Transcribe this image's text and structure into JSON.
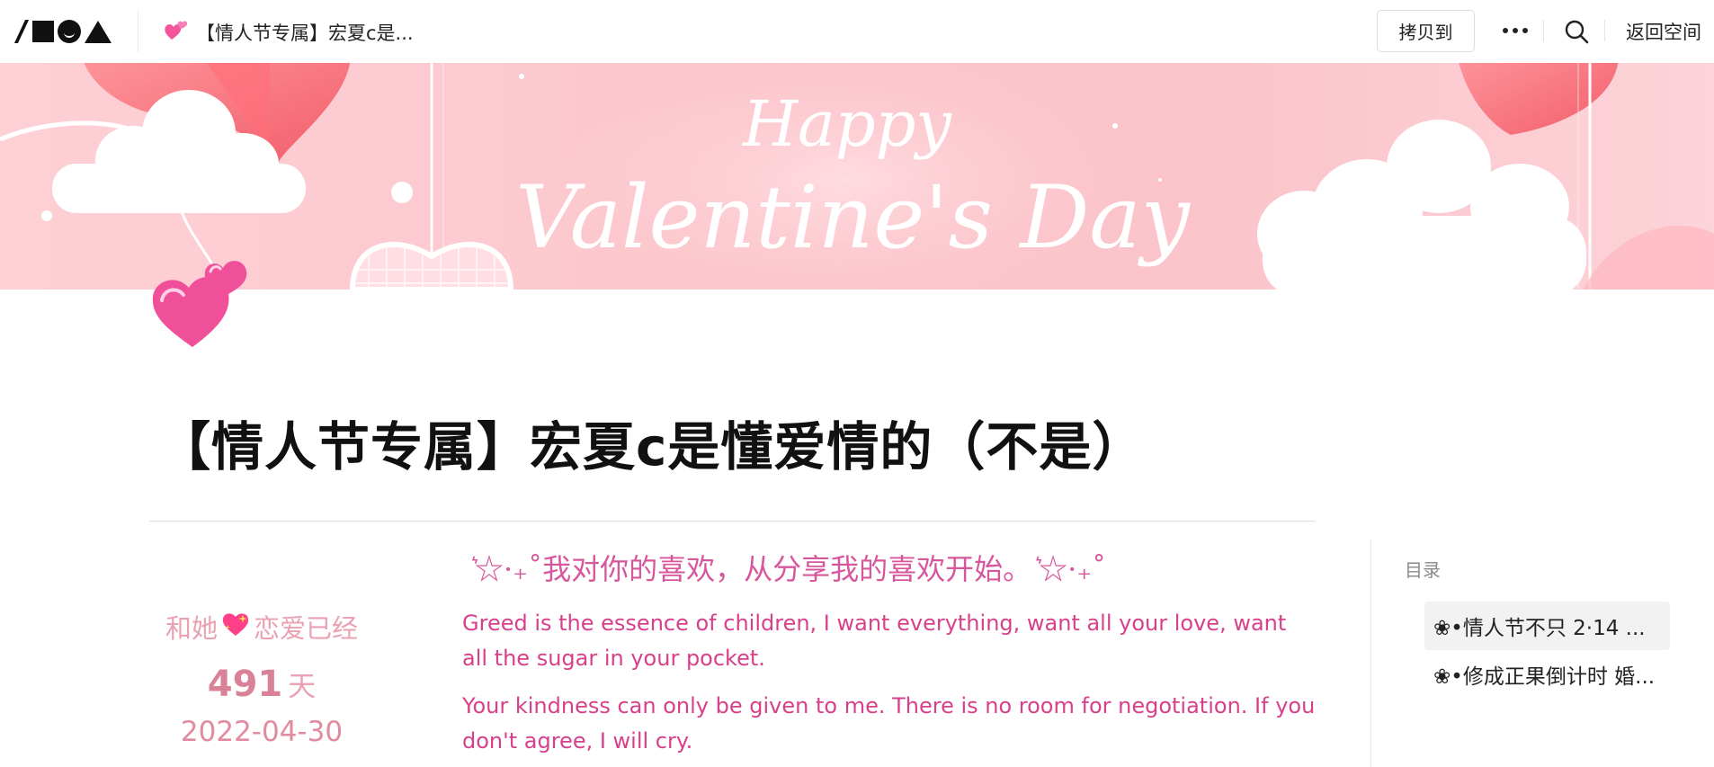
{
  "topbar": {
    "doc_title": "【情人节专属】宏夏c是...",
    "copy_label": "拷贝到",
    "back_label": "返回空间"
  },
  "banner": {
    "script_line1": "Happy",
    "script_line2": "Valentine's Day"
  },
  "page": {
    "title": "【情人节专属】宏夏c是懂爱情的（不是）"
  },
  "counter": {
    "prefix": "和她",
    "suffix": "恋爱已经",
    "days": "491",
    "unit": "天",
    "date": "2022-04-30"
  },
  "content": {
    "quote": "͛☆·₊˚我对你的喜欢，从分享我的喜欢开始。 ͛☆·₊˚",
    "paragraphs": [
      "Greed is the essence of children, I want everything, want all your love, want all the sugar in your pocket.",
      "Your kindness can only be given to me. There is no room for negotiation. If you don't agree, I will cry."
    ]
  },
  "toc": {
    "heading": "目录",
    "items": [
      "❀•情人节不只 2·14 ...",
      "❀•修成正果倒计时 婚..."
    ]
  },
  "colors": {
    "banner_pink": "#fcc6cc",
    "accent_pink": "#d8408c",
    "counter_pink": "#e28aa0"
  },
  "icons": {
    "title_icon": "two-hearts-icon",
    "page_icon": "two-hearts-icon",
    "counter_icon": "sparkling-heart-icon",
    "more": "more-dots-icon",
    "search": "search-icon"
  }
}
